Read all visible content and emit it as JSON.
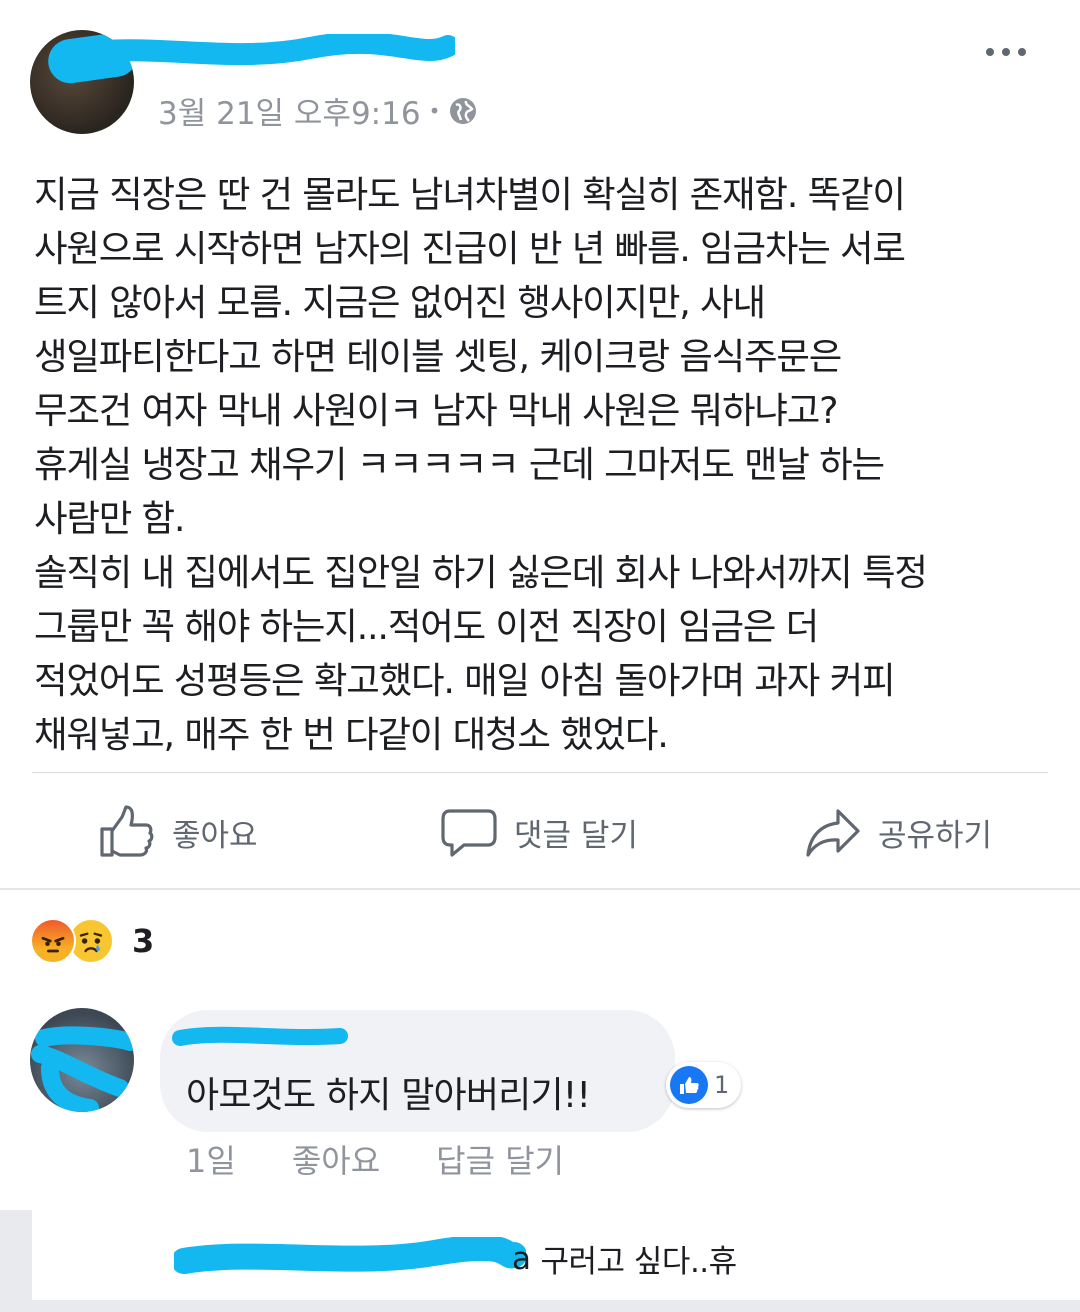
{
  "post": {
    "author_redacted": "redacted",
    "date": "3월 21일 오후9:16",
    "dot": "•",
    "audience_icon": "globe-icon",
    "more_icon": "more-icon",
    "body": "지금 직장은 딴 건 몰라도 남녀차별이 확실히 존재함. 똑같이\n사원으로 시작하면 남자의 진급이 반 년 빠름. 임금차는 서로\n트지 않아서 모름. 지금은 없어진 행사이지만, 사내\n생일파티한다고 하면 테이블 셋팅, 케이크랑 음식주문은\n무조건 여자 막내 사원이ㅋ 남자 막내 사원은 뭐하냐고?\n휴게실 냉장고 채우기 ㅋㅋㅋㅋㅋ 근데 그마저도 맨날 하는\n사람만 함.\n솔직히 내 집에서도 집안일 하기 싫은데 회사 나와서까지 특정\n그룹만 꼭 해야 하는지...적어도 이전 직장이 임금은 더\n적었어도 성평등은 확고했다. 매일 아침 돌아가며 과자 커피\n채워넣고, 매주 한 번 다같이 대청소 했었다."
  },
  "actions": {
    "like_label": "좋아요",
    "comment_label": "댓글 달기",
    "share_label": "공유하기"
  },
  "reactions": {
    "icons": [
      "angry-reaction",
      "sad-reaction"
    ],
    "count": "3"
  },
  "comment": {
    "author_redacted": "redacted",
    "text": "아모것도 하지 말아버리기!!",
    "like_count": "1",
    "time": "1일",
    "like_label": "좋아요",
    "reply_label": "답글 달기"
  },
  "reply_preview": {
    "text": "구러고 싶다..휴",
    "prefix_visible": "a"
  },
  "colors": {
    "redaction": "#14b8f0",
    "like_blue": "#1877f2",
    "muted_text": "#90949c"
  }
}
